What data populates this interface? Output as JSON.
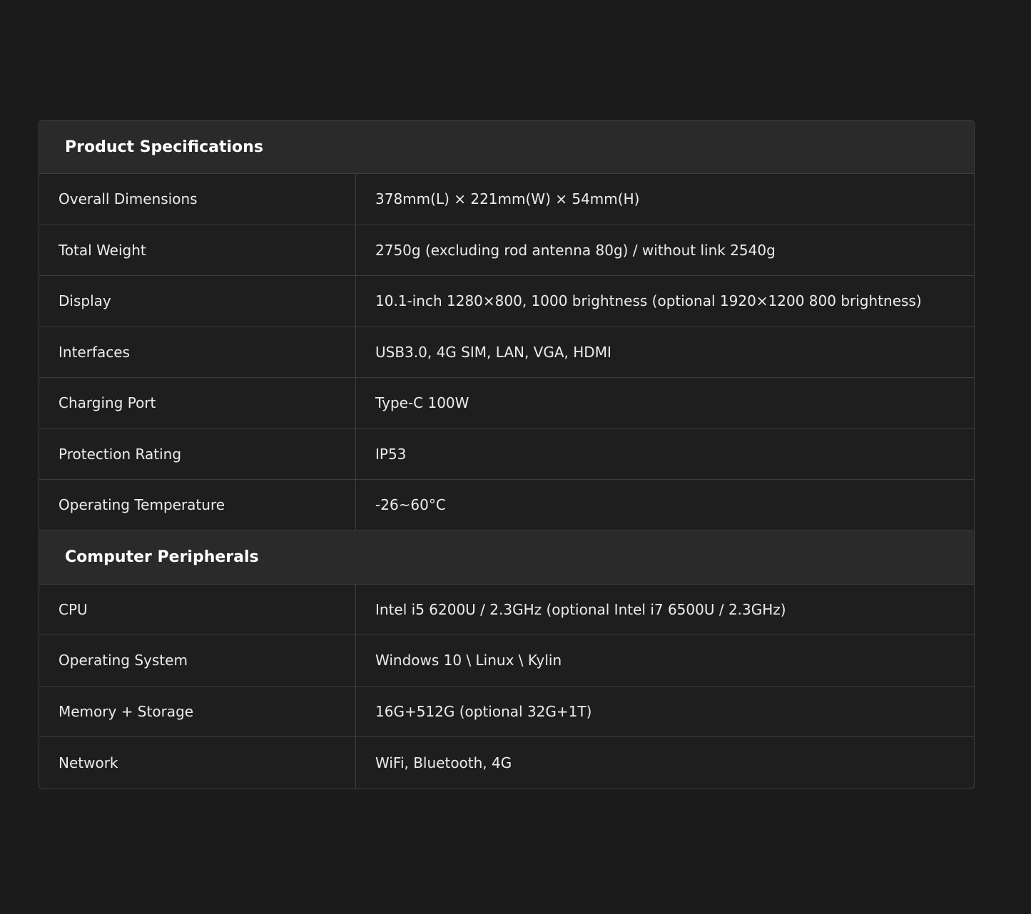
{
  "sections": [
    {
      "title": "Product Specifications",
      "rows": [
        {
          "label": "Overall Dimensions",
          "value": "378mm(L) × 221mm(W) × 54mm(H)"
        },
        {
          "label": "Total Weight",
          "value": "2750g (excluding rod antenna 80g) / without link 2540g"
        },
        {
          "label": "Display",
          "value": "10.1-inch 1280×800, 1000 brightness (optional 1920×1200 800 brightness)"
        },
        {
          "label": "Interfaces",
          "value": "USB3.0, 4G SIM, LAN, VGA, HDMI"
        },
        {
          "label": "Charging Port",
          "value": "Type-C 100W"
        },
        {
          "label": "Protection Rating",
          "value": "IP53"
        },
        {
          "label": "Operating Temperature",
          "value": "-26~60°C"
        }
      ]
    },
    {
      "title": "Computer Peripherals",
      "rows": [
        {
          "label": "CPU",
          "value": "Intel i5 6200U / 2.3GHz (optional Intel i7 6500U / 2.3GHz)"
        },
        {
          "label": "Operating System",
          "value": "Windows 10 \\ Linux \\ Kylin"
        },
        {
          "label": "Memory + Storage",
          "value": "16G+512G (optional 32G+1T)"
        },
        {
          "label": "Network",
          "value": "WiFi, Bluetooth, 4G"
        }
      ]
    }
  ]
}
